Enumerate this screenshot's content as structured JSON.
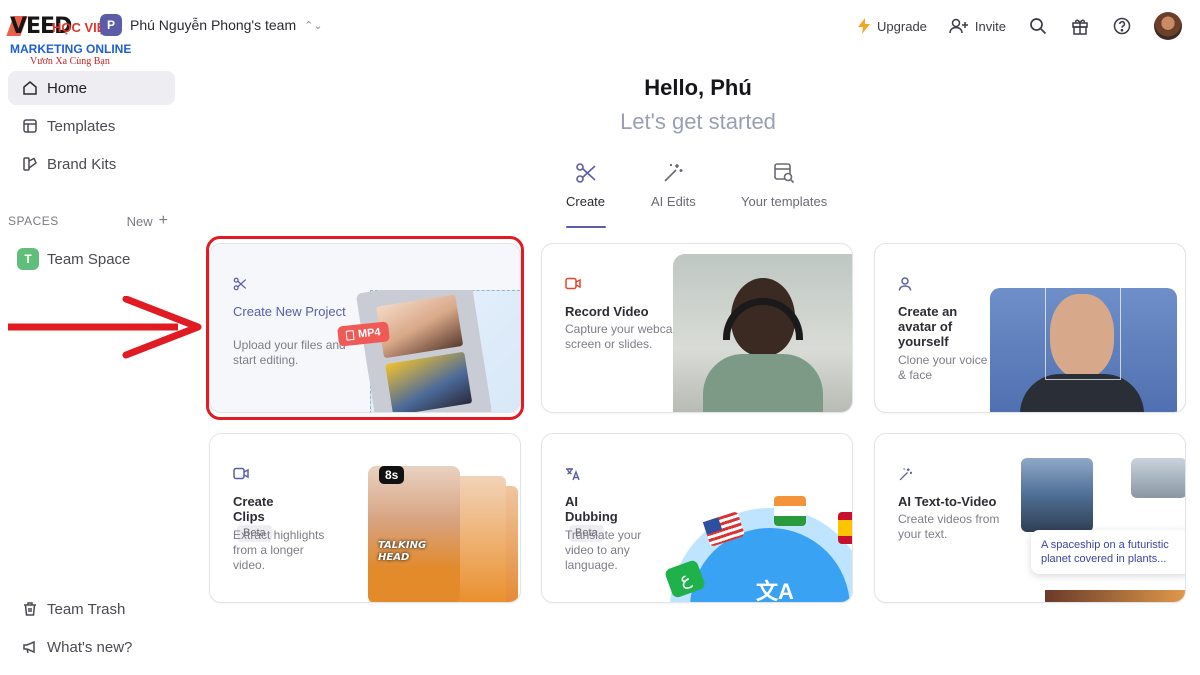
{
  "brand": {
    "logo_text": "VEED",
    "watermark_line1": "HỌC VIỆN",
    "watermark_line2": "MARKETING ONLINE",
    "watermark_line3": "Vươn Xa Cùng Bạn"
  },
  "team": {
    "initial": "P",
    "name": "Phú Nguyễn Phong's team"
  },
  "topbar": {
    "upgrade_label": "Upgrade",
    "invite_label": "Invite"
  },
  "sidebar": {
    "items": [
      {
        "label": "Home"
      },
      {
        "label": "Templates"
      },
      {
        "label": "Brand Kits"
      }
    ],
    "spaces_heading": "SPACES",
    "new_label": "New",
    "team_space": {
      "initial": "T",
      "label": "Team Space"
    },
    "trash_label": "Team Trash",
    "whats_new_label": "What's new?"
  },
  "main": {
    "greeting": "Hello, Phú",
    "subtitle": "Let's get started",
    "tabs": [
      {
        "label": "Create"
      },
      {
        "label": "AI Edits"
      },
      {
        "label": "Your templates"
      }
    ],
    "cards": [
      {
        "title": "Create New Project",
        "desc": "Upload your files and start editing.",
        "badge": "MP4"
      },
      {
        "title": "Record Video",
        "desc": "Capture your webcam, screen or slides."
      },
      {
        "title": "Create an avatar of yourself",
        "desc": "Clone your voice & face"
      },
      {
        "title": "Create Clips",
        "beta": "Beta",
        "desc": "Extract highlights from a longer video.",
        "duration": "8s",
        "overlay": "TALKING HEAD"
      },
      {
        "title": "AI Dubbing",
        "beta": "Beta",
        "desc": "Translate your video to any language."
      },
      {
        "title": "AI Text-to-Video",
        "desc": "Create videos from your text.",
        "prompt": "A spaceship on a futuristic planet covered in plants..."
      }
    ]
  },
  "colors": {
    "accent": "#5b5ea6",
    "highlight": "#e01b22",
    "upgrade": "#f5a524"
  }
}
